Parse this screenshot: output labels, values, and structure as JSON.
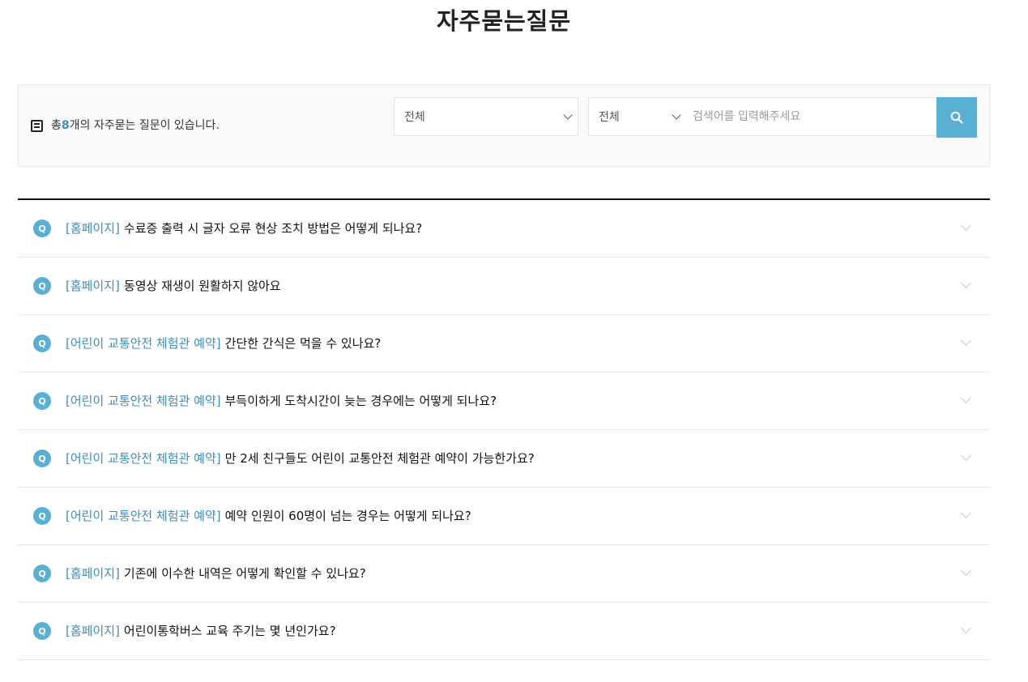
{
  "page": {
    "title": "자주묻는질문"
  },
  "search": {
    "count_prefix": "총 ",
    "count": "8",
    "count_suffix": "개의 자주묻는 질문이 있습니다.",
    "category_select_value": "전체",
    "field_select_value": "전체",
    "input_placeholder": "검색어를 입력해주세요",
    "input_value": "",
    "button_icon": "search-icon"
  },
  "faq": {
    "items": [
      {
        "category": "[홈페이지]",
        "question": "수료증 출력 시 글자 오류 현상 조치 방법은 어떻게 되나요?"
      },
      {
        "category": "[홈페이지]",
        "question": "동영상 재생이 원활하지 않아요"
      },
      {
        "category": "[어린이 교통안전 체험관 예약]",
        "question": "간단한 간식은 먹을 수 있나요?"
      },
      {
        "category": "[어린이 교통안전 체험관 예약]",
        "question": "부득이하게 도착시간이 늦는 경우에는 어떻게 되나요?"
      },
      {
        "category": "[어린이 교통안전 체험관 예약]",
        "question": "만 2세 친구들도 어린이 교통안전 체험관 예약이 가능한가요?"
      },
      {
        "category": "[어린이 교통안전 체험관 예약]",
        "question": "예약 인원이 60명이 넘는 경우는 어떻게 되나요?"
      },
      {
        "category": "[홈페이지]",
        "question": "기존에 이수한 내역은 어떻게 확인할 수 있나요?"
      },
      {
        "category": "[홈페이지]",
        "question": "어린이통학버스 교육 주기는 몇 년인가요?"
      }
    ],
    "q_badge": "Q"
  },
  "colors": {
    "accent": "#5ab0d3",
    "category_text": "#3c8dbc",
    "border_dark": "#111111"
  }
}
